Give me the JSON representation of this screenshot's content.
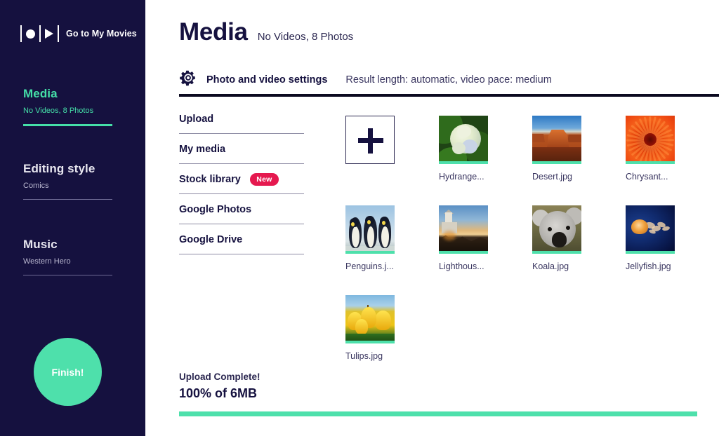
{
  "sidebar": {
    "logo": {
      "icon": "play-record-logo-icon",
      "text": "Go to My Movies"
    },
    "sections": [
      {
        "title": "Media",
        "subtitle": "No Videos, 8 Photos",
        "active": true
      },
      {
        "title": "Editing style",
        "subtitle": "Comics",
        "active": false
      },
      {
        "title": "Music",
        "subtitle": "Western Hero",
        "active": false
      }
    ],
    "finish_button": "Finish!"
  },
  "header": {
    "title": "Media",
    "subtitle": "No Videos, 8 Photos"
  },
  "settings": {
    "icon": "gear-icon",
    "label": "Photo and video settings",
    "value": "Result length: automatic, video pace: medium"
  },
  "sources": [
    {
      "label": "Upload",
      "badge": null
    },
    {
      "label": "My media",
      "badge": null
    },
    {
      "label": "Stock library",
      "badge": "New"
    },
    {
      "label": "Google Photos",
      "badge": null
    },
    {
      "label": "Google Drive",
      "badge": null
    }
  ],
  "add_tile": {
    "icon": "plus-icon",
    "label": ""
  },
  "thumbnails": [
    {
      "caption": "Hydrange...",
      "art": "art-hydrangea"
    },
    {
      "caption": "Desert.jpg",
      "art": "art-desert"
    },
    {
      "caption": "Chrysant...",
      "art": "art-chrys"
    },
    {
      "caption": "Penguins.j...",
      "art": "art-penguins"
    },
    {
      "caption": "Lighthous...",
      "art": "art-lighthouse"
    },
    {
      "caption": "Koala.jpg",
      "art": "art-koala"
    },
    {
      "caption": "Jellyfish.jpg",
      "art": "art-jellyfish"
    },
    {
      "caption": "Tulips.jpg",
      "art": "art-tulips"
    }
  ],
  "upload": {
    "status": "Upload Complete!",
    "progress_text": "100% of 6MB",
    "progress_percent": 100
  },
  "colors": {
    "sidebar_bg": "#15113f",
    "accent_mint": "#4ee0ab",
    "badge_pink": "#e5194f",
    "ink": "#15113f"
  }
}
